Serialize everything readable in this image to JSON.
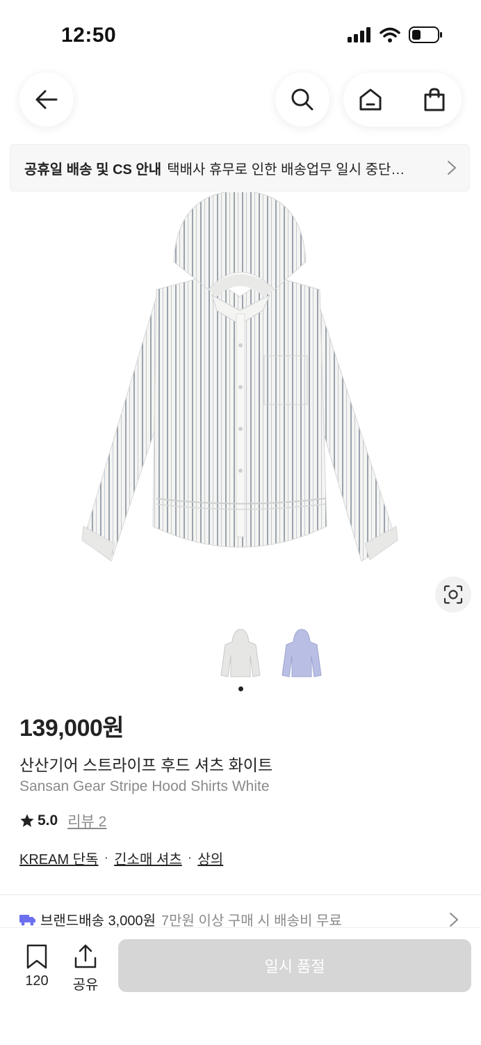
{
  "status_bar": {
    "time": "12:50"
  },
  "notice": {
    "title": "공휴일 배송 및 CS 안내",
    "text": "택배사 휴무로 인한 배송업무 일시 중단…"
  },
  "product": {
    "price": "139,000원",
    "name_ko": "산산기어 스트라이프 후드 셔츠 화이트",
    "name_en": "Sansan Gear Stripe Hood Shirts White",
    "rating": "5.0",
    "review_label": "리뷰 2",
    "categories": [
      "KREAM 단독",
      "긴소매 셔츠",
      "상의"
    ],
    "category_sep": "·"
  },
  "shipping": {
    "label": "브랜드배송 3,000원",
    "note": "7만원 이상 구매 시 배송비 무료"
  },
  "bottom": {
    "bookmark_count": "120",
    "share_label": "공유",
    "cta": "일시 품절"
  },
  "icons": [
    "back-arrow-icon",
    "search-icon",
    "home-icon",
    "shopping-bag-icon",
    "chevron-right-icon",
    "lens-search-icon",
    "star-icon",
    "truck-icon",
    "bookmark-icon",
    "share-icon"
  ],
  "colors": {
    "accent_truck": "#6b6ff0",
    "soldout_bg": "#d6d6d6"
  }
}
